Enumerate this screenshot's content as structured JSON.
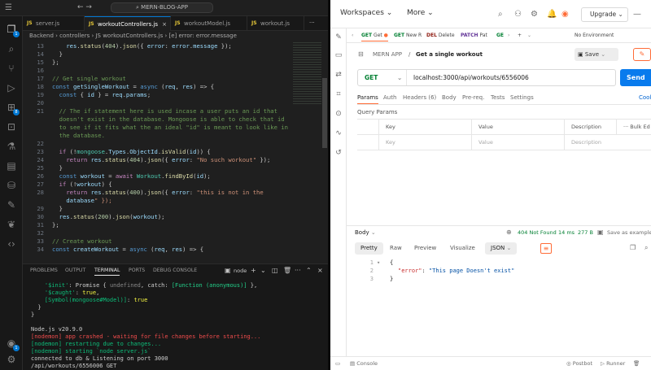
{
  "vscode": {
    "search_text": "MERN-BLOG-APP",
    "tabs": [
      {
        "label": "server.js",
        "active": false
      },
      {
        "label": "workoutControllers.js",
        "active": true
      },
      {
        "label": "workoutModel.js",
        "active": false
      },
      {
        "label": "workout.js",
        "active": false
      }
    ],
    "breadcrumb": "Backend › controllers › JS workoutControllers.js › [e] error: error.message",
    "code_lines": [
      {
        "n": "13",
        "t": "    res.status(404).json({ error: error.message });"
      },
      {
        "n": "14",
        "t": "  }"
      },
      {
        "n": "15",
        "t": "};"
      },
      {
        "n": "16",
        "t": ""
      },
      {
        "n": "17",
        "t": "// Get single workout"
      },
      {
        "n": "18",
        "t": "const getSingleWorkout = async (req, res) => {"
      },
      {
        "n": "19",
        "t": "  const { id } = req.params;"
      },
      {
        "n": "20",
        "t": ""
      },
      {
        "n": "21",
        "t": "  // The if statement here is used incase a user puts an id that"
      },
      {
        "n": "",
        "t": "  doesn't exist in the database. Mongoose is able to check that id"
      },
      {
        "n": "",
        "t": "  to see if it fits what the an ideal \"id\" is meant to look like in"
      },
      {
        "n": "",
        "t": "  the database."
      },
      {
        "n": "22",
        "t": ""
      },
      {
        "n": "23",
        "t": "  if (!mongoose.Types.ObjectId.isValid(id)) {"
      },
      {
        "n": "24",
        "t": "    return res.status(404).json({ error: \"No such workout\" });"
      },
      {
        "n": "25",
        "t": "  }"
      },
      {
        "n": "26",
        "t": "  const workout = await Workout.findById(id);"
      },
      {
        "n": "27",
        "t": "  if (!workout) {"
      },
      {
        "n": "28",
        "t": "    return res.status(400).json({ error: \"this is not in the"
      },
      {
        "n": "",
        "t": "    database\" });"
      },
      {
        "n": "29",
        "t": "  }"
      },
      {
        "n": "30",
        "t": "  res.status(200).json(workout);"
      },
      {
        "n": "31",
        "t": "};"
      },
      {
        "n": "32",
        "t": ""
      },
      {
        "n": "33",
        "t": "// Create workout"
      },
      {
        "n": "34",
        "t": "const createWorkout = async (req, res) => {"
      }
    ],
    "panel_tabs": [
      "PROBLEMS",
      "OUTPUT",
      "TERMINAL",
      "PORTS",
      "DEBUG CONSOLE"
    ],
    "terminal_shell": "node",
    "terminal_lines": [
      "    '$init': Promise { undefined, catch: [Function (anonymous)] },",
      "    '$caught': true,",
      "    [Symbol(mongoose#Model)]: true",
      "  }",
      "}",
      "",
      "Node.js v20.9.0",
      "[nodemon] app crashed - waiting for file changes before starting...",
      "[nodemon] restarting due to changes...",
      "[nodemon] starting `node server.js`",
      "connected to db & Listening on port 3000",
      "/api/workouts/6556006 GET"
    ]
  },
  "postman": {
    "workspaces": "Workspaces",
    "more": "More",
    "upgrade": "Upgrade",
    "tabs": [
      {
        "method": "GET",
        "label": "Get",
        "dot": true
      },
      {
        "method": "GET",
        "label": "New R"
      },
      {
        "method": "DEL",
        "label": "Delete"
      },
      {
        "method": "PATCH",
        "label": "Pat"
      },
      {
        "method": "GE",
        "label": ""
      }
    ],
    "environment": "No Environment",
    "breadcrumb_parent": "MERN APP",
    "breadcrumb_sep": "/",
    "request_name": "Get a single workout",
    "save": "Save",
    "method": "GET",
    "url": "localhost:3000/api/workouts/6556006",
    "send": "Send",
    "subtabs": [
      "Params",
      "Auth",
      "Headers (6)",
      "Body",
      "Pre-req.",
      "Tests",
      "Settings"
    ],
    "cookies": "Cook",
    "query_params_title": "Query Params",
    "table_headers": [
      "Key",
      "Value",
      "Description",
      "Bulk Ed"
    ],
    "placeholders": {
      "key": "Key",
      "value": "Value",
      "description": "Description"
    },
    "response": {
      "label": "Body",
      "status": "404 Not Found",
      "time": "14 ms",
      "size": "277 B",
      "save_as": "Save as example",
      "views": [
        "Pretty",
        "Raw",
        "Preview",
        "Visualize"
      ],
      "format": "JSON",
      "lines": [
        {
          "n": "1",
          "t": "{"
        },
        {
          "n": "2",
          "k": "\"error\"",
          "v": "\"This page Doesn't exist\""
        },
        {
          "n": "3",
          "t": "}"
        }
      ]
    },
    "footer_left": "Console",
    "footer_postbot": "Postbot",
    "footer_runner": "Runner"
  },
  "colors": {
    "vscode_bg": "#1f1f1f",
    "accent": "#0078d4",
    "postman_orange": "#ff6c37",
    "send_blue": "#097bed",
    "status_green": "#007f31"
  }
}
